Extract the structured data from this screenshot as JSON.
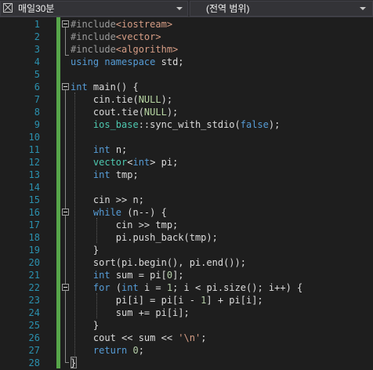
{
  "toolbar": {
    "scope_label": "매일30분",
    "scope_icon": "project-icon",
    "range_label": "(전역 범위)"
  },
  "gutter": {
    "line_numbers": [
      "1",
      "2",
      "3",
      "4",
      "5",
      "6",
      "7",
      "8",
      "9",
      "10",
      "11",
      "12",
      "13",
      "14",
      "15",
      "16",
      "17",
      "18",
      "19",
      "20",
      "21",
      "22",
      "23",
      "24",
      "25",
      "26",
      "27",
      "28"
    ]
  },
  "colors": {
    "background": "#1e1e1e",
    "line_number": "#2b91af",
    "change_bar": "#57a64a",
    "keyword": "#569cd6",
    "type": "#4ec9b0",
    "preprocessor": "#9b9b9b",
    "include_header": "#d69d85",
    "number": "#b5cea8",
    "plain_text": "#dcdcdc"
  },
  "code": [
    [
      {
        "t": "#include",
        "c": "pp"
      },
      {
        "t": "<iostream>",
        "c": "hdr"
      }
    ],
    [
      {
        "t": "#include",
        "c": "pp"
      },
      {
        "t": "<vector>",
        "c": "hdr"
      }
    ],
    [
      {
        "t": "#include",
        "c": "pp"
      },
      {
        "t": "<algorithm>",
        "c": "hdr"
      }
    ],
    [
      {
        "t": "using",
        "c": "kw"
      },
      {
        "t": " "
      },
      {
        "t": "namespace",
        "c": "kw"
      },
      {
        "t": " std;"
      }
    ],
    [],
    [
      {
        "t": "int",
        "c": "kw"
      },
      {
        "t": " main() {"
      }
    ],
    [
      {
        "t": "    cin.tie("
      },
      {
        "t": "NULL",
        "c": "nul"
      },
      {
        "t": ");"
      }
    ],
    [
      {
        "t": "    cout.tie("
      },
      {
        "t": "NULL",
        "c": "nul"
      },
      {
        "t": ");"
      }
    ],
    [
      {
        "t": "    "
      },
      {
        "t": "ios_base",
        "c": "ty"
      },
      {
        "t": "::sync_with_stdio("
      },
      {
        "t": "false",
        "c": "kw"
      },
      {
        "t": ");"
      }
    ],
    [],
    [
      {
        "t": "    "
      },
      {
        "t": "int",
        "c": "kw"
      },
      {
        "t": " n;"
      }
    ],
    [
      {
        "t": "    "
      },
      {
        "t": "vector",
        "c": "ty"
      },
      {
        "t": "<"
      },
      {
        "t": "int",
        "c": "kw"
      },
      {
        "t": "> pi;"
      }
    ],
    [
      {
        "t": "    "
      },
      {
        "t": "int",
        "c": "kw"
      },
      {
        "t": " tmp;"
      }
    ],
    [],
    [
      {
        "t": "    cin >> n;"
      }
    ],
    [
      {
        "t": "    "
      },
      {
        "t": "while",
        "c": "kw"
      },
      {
        "t": " (n--) {"
      }
    ],
    [
      {
        "t": "        cin >> tmp;"
      }
    ],
    [
      {
        "t": "        pi.push_back(tmp);"
      }
    ],
    [
      {
        "t": "    }"
      }
    ],
    [
      {
        "t": "    sort(pi.begin(), pi.end());"
      }
    ],
    [
      {
        "t": "    "
      },
      {
        "t": "int",
        "c": "kw"
      },
      {
        "t": " sum = pi["
      },
      {
        "t": "0",
        "c": "num"
      },
      {
        "t": "];"
      }
    ],
    [
      {
        "t": "    "
      },
      {
        "t": "for",
        "c": "kw"
      },
      {
        "t": " ("
      },
      {
        "t": "int",
        "c": "kw"
      },
      {
        "t": " i = "
      },
      {
        "t": "1",
        "c": "num"
      },
      {
        "t": "; i < pi.size(); i++) {"
      }
    ],
    [
      {
        "t": "        pi[i] = pi[i - "
      },
      {
        "t": "1",
        "c": "num"
      },
      {
        "t": "] + pi[i];"
      }
    ],
    [
      {
        "t": "        sum += pi[i];"
      }
    ],
    [
      {
        "t": "    }"
      }
    ],
    [
      {
        "t": "    cout << sum << "
      },
      {
        "t": "'\\n'",
        "c": "str"
      },
      {
        "t": ";"
      }
    ],
    [
      {
        "t": "    "
      },
      {
        "t": "return",
        "c": "kw"
      },
      {
        "t": " "
      },
      {
        "t": "0",
        "c": "num"
      },
      {
        "t": ";"
      }
    ],
    [
      {
        "t": "}"
      }
    ]
  ]
}
